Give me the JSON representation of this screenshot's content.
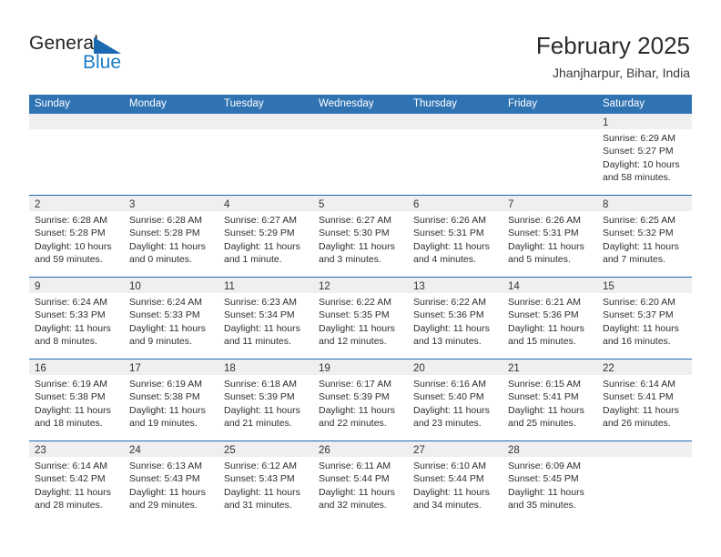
{
  "brand": {
    "name_part1": "General",
    "name_part2": "Blue",
    "triangle_icon": "triangle-icon",
    "colors": {
      "dark": "#231f20",
      "blue": "#1b7ec4",
      "triangle": "#1b69b0"
    }
  },
  "header": {
    "title": "February 2025",
    "subtitle": "Jhanjharpur, Bihar, India"
  },
  "theme": {
    "header_blue": "#3073b3",
    "row_divider_blue": "#1b69b0",
    "daynum_band": "#efefef",
    "text": "#2d2d2d"
  },
  "calendar": {
    "weekday_headers": [
      "Sunday",
      "Monday",
      "Tuesday",
      "Wednesday",
      "Thursday",
      "Friday",
      "Saturday"
    ],
    "weeks": [
      [
        {
          "day": "",
          "lines": []
        },
        {
          "day": "",
          "lines": []
        },
        {
          "day": "",
          "lines": []
        },
        {
          "day": "",
          "lines": []
        },
        {
          "day": "",
          "lines": []
        },
        {
          "day": "",
          "lines": []
        },
        {
          "day": "1",
          "lines": [
            "Sunrise: 6:29 AM",
            "Sunset: 5:27 PM",
            "Daylight: 10 hours",
            "and 58 minutes."
          ]
        }
      ],
      [
        {
          "day": "2",
          "lines": [
            "Sunrise: 6:28 AM",
            "Sunset: 5:28 PM",
            "Daylight: 10 hours",
            "and 59 minutes."
          ]
        },
        {
          "day": "3",
          "lines": [
            "Sunrise: 6:28 AM",
            "Sunset: 5:28 PM",
            "Daylight: 11 hours",
            "and 0 minutes."
          ]
        },
        {
          "day": "4",
          "lines": [
            "Sunrise: 6:27 AM",
            "Sunset: 5:29 PM",
            "Daylight: 11 hours",
            "and 1 minute."
          ]
        },
        {
          "day": "5",
          "lines": [
            "Sunrise: 6:27 AM",
            "Sunset: 5:30 PM",
            "Daylight: 11 hours",
            "and 3 minutes."
          ]
        },
        {
          "day": "6",
          "lines": [
            "Sunrise: 6:26 AM",
            "Sunset: 5:31 PM",
            "Daylight: 11 hours",
            "and 4 minutes."
          ]
        },
        {
          "day": "7",
          "lines": [
            "Sunrise: 6:26 AM",
            "Sunset: 5:31 PM",
            "Daylight: 11 hours",
            "and 5 minutes."
          ]
        },
        {
          "day": "8",
          "lines": [
            "Sunrise: 6:25 AM",
            "Sunset: 5:32 PM",
            "Daylight: 11 hours",
            "and 7 minutes."
          ]
        }
      ],
      [
        {
          "day": "9",
          "lines": [
            "Sunrise: 6:24 AM",
            "Sunset: 5:33 PM",
            "Daylight: 11 hours",
            "and 8 minutes."
          ]
        },
        {
          "day": "10",
          "lines": [
            "Sunrise: 6:24 AM",
            "Sunset: 5:33 PM",
            "Daylight: 11 hours",
            "and 9 minutes."
          ]
        },
        {
          "day": "11",
          "lines": [
            "Sunrise: 6:23 AM",
            "Sunset: 5:34 PM",
            "Daylight: 11 hours",
            "and 11 minutes."
          ]
        },
        {
          "day": "12",
          "lines": [
            "Sunrise: 6:22 AM",
            "Sunset: 5:35 PM",
            "Daylight: 11 hours",
            "and 12 minutes."
          ]
        },
        {
          "day": "13",
          "lines": [
            "Sunrise: 6:22 AM",
            "Sunset: 5:36 PM",
            "Daylight: 11 hours",
            "and 13 minutes."
          ]
        },
        {
          "day": "14",
          "lines": [
            "Sunrise: 6:21 AM",
            "Sunset: 5:36 PM",
            "Daylight: 11 hours",
            "and 15 minutes."
          ]
        },
        {
          "day": "15",
          "lines": [
            "Sunrise: 6:20 AM",
            "Sunset: 5:37 PM",
            "Daylight: 11 hours",
            "and 16 minutes."
          ]
        }
      ],
      [
        {
          "day": "16",
          "lines": [
            "Sunrise: 6:19 AM",
            "Sunset: 5:38 PM",
            "Daylight: 11 hours",
            "and 18 minutes."
          ]
        },
        {
          "day": "17",
          "lines": [
            "Sunrise: 6:19 AM",
            "Sunset: 5:38 PM",
            "Daylight: 11 hours",
            "and 19 minutes."
          ]
        },
        {
          "day": "18",
          "lines": [
            "Sunrise: 6:18 AM",
            "Sunset: 5:39 PM",
            "Daylight: 11 hours",
            "and 21 minutes."
          ]
        },
        {
          "day": "19",
          "lines": [
            "Sunrise: 6:17 AM",
            "Sunset: 5:39 PM",
            "Daylight: 11 hours",
            "and 22 minutes."
          ]
        },
        {
          "day": "20",
          "lines": [
            "Sunrise: 6:16 AM",
            "Sunset: 5:40 PM",
            "Daylight: 11 hours",
            "and 23 minutes."
          ]
        },
        {
          "day": "21",
          "lines": [
            "Sunrise: 6:15 AM",
            "Sunset: 5:41 PM",
            "Daylight: 11 hours",
            "and 25 minutes."
          ]
        },
        {
          "day": "22",
          "lines": [
            "Sunrise: 6:14 AM",
            "Sunset: 5:41 PM",
            "Daylight: 11 hours",
            "and 26 minutes."
          ]
        }
      ],
      [
        {
          "day": "23",
          "lines": [
            "Sunrise: 6:14 AM",
            "Sunset: 5:42 PM",
            "Daylight: 11 hours",
            "and 28 minutes."
          ]
        },
        {
          "day": "24",
          "lines": [
            "Sunrise: 6:13 AM",
            "Sunset: 5:43 PM",
            "Daylight: 11 hours",
            "and 29 minutes."
          ]
        },
        {
          "day": "25",
          "lines": [
            "Sunrise: 6:12 AM",
            "Sunset: 5:43 PM",
            "Daylight: 11 hours",
            "and 31 minutes."
          ]
        },
        {
          "day": "26",
          "lines": [
            "Sunrise: 6:11 AM",
            "Sunset: 5:44 PM",
            "Daylight: 11 hours",
            "and 32 minutes."
          ]
        },
        {
          "day": "27",
          "lines": [
            "Sunrise: 6:10 AM",
            "Sunset: 5:44 PM",
            "Daylight: 11 hours",
            "and 34 minutes."
          ]
        },
        {
          "day": "28",
          "lines": [
            "Sunrise: 6:09 AM",
            "Sunset: 5:45 PM",
            "Daylight: 11 hours",
            "and 35 minutes."
          ]
        },
        {
          "day": "",
          "lines": []
        }
      ]
    ]
  }
}
